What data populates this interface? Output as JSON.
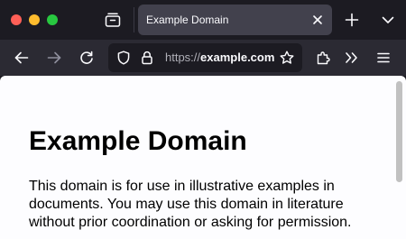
{
  "window": {
    "controls": [
      "close",
      "minimize",
      "maximize"
    ],
    "colors": {
      "close": "#ff5f57",
      "minimize": "#febc2e",
      "maximize": "#28c840"
    }
  },
  "tabs": [
    {
      "title": "Example Domain",
      "active": true
    }
  ],
  "toolbar": {
    "icons": [
      "back-arrow-icon",
      "forward-arrow-icon",
      "reload-icon",
      "bookmark-star-icon",
      "extensions-puzzle-icon",
      "overflow-chevrons-icon",
      "hamburger-menu-icon"
    ]
  },
  "urlbar": {
    "scheme": "https://",
    "domain": "example.com",
    "icons": [
      "shield-icon",
      "lock-icon"
    ]
  },
  "page": {
    "heading": "Example Domain",
    "paragraph": "This domain is for use in illustrative examples in documents. You may use this domain in literature without prior coordination or asking for permission."
  }
}
